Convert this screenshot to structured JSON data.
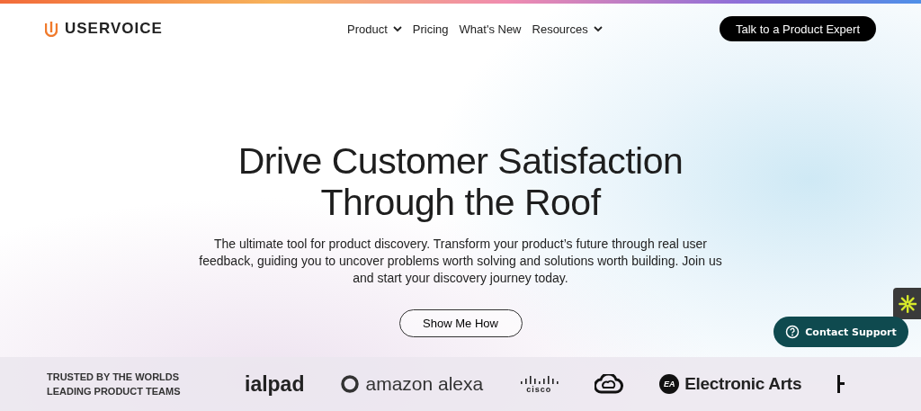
{
  "header": {
    "brand": "USERVOICE",
    "nav": [
      {
        "label": "Product",
        "dropdown": true
      },
      {
        "label": "Pricing",
        "dropdown": false
      },
      {
        "label": "What's New",
        "dropdown": false
      },
      {
        "label": "Resources",
        "dropdown": true
      }
    ],
    "cta": "Talk to a Product Expert"
  },
  "hero": {
    "title_lines": [
      "Drive Customer Satisfaction",
      "Through the Roof"
    ],
    "subtitle": "The ultimate tool for product discovery. Transform your product’s future through real user feedback, guiding you to uncover problems worth solving and solutions worth building. Join us and start your discovery journey today.",
    "button": "Show Me How"
  },
  "trusted": {
    "label_lines": [
      "TRUSTED BY THE WORLDS",
      "LEADING PRODUCT TEAMS"
    ],
    "logos": [
      {
        "kind": "wordmark",
        "text": "ialpad"
      },
      {
        "kind": "ring",
        "text": "amazon alexa"
      },
      {
        "kind": "bars",
        "text": "cisco"
      },
      {
        "kind": "cloud"
      },
      {
        "kind": "badge",
        "badge": "EA",
        "text": "Electronic Arts"
      },
      {
        "kind": "stub"
      }
    ]
  },
  "support": {
    "label": "Contact Support"
  }
}
